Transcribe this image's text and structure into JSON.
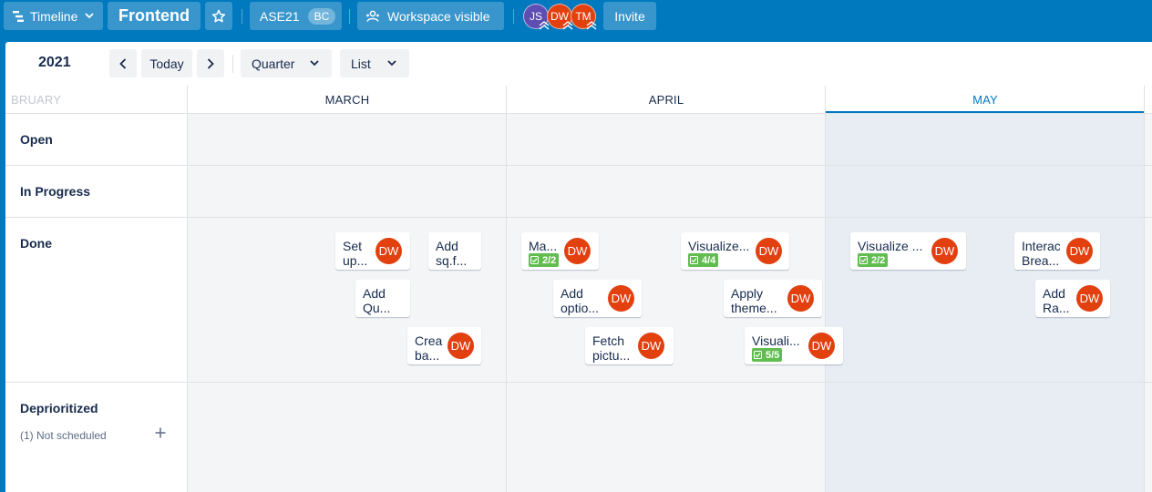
{
  "topbar": {
    "view_switcher": "Timeline",
    "board_name": "Frontend",
    "workspace_name": "ASE21",
    "workspace_badge": "BC",
    "visibility": "Workspace visible",
    "members": [
      "JS",
      "DW",
      "TM"
    ],
    "invite": "Invite"
  },
  "toolbar": {
    "year": "2021",
    "today": "Today",
    "range": "Quarter",
    "group_by": "List"
  },
  "months": {
    "prev": "BRUARY",
    "m1": "MARCH",
    "m2": "APRIL",
    "m3": "MAY"
  },
  "lanes": {
    "open": "Open",
    "in_progress": "In Progress",
    "done": "Done",
    "deprioritized": "Deprioritized",
    "not_scheduled": "(1) Not scheduled"
  },
  "cards": {
    "c1": {
      "line1": "Set",
      "line2": "up...",
      "member": "DW"
    },
    "c2": {
      "line1": "Add",
      "line2": "sq.f..."
    },
    "c3": {
      "line1": "Add",
      "line2": "Qu..."
    },
    "c4": {
      "line1": "Crea",
      "line2": "ba...",
      "member": "DW"
    },
    "c5": {
      "line1": "Ma...",
      "badge": "2/2",
      "member": "DW"
    },
    "c6": {
      "line1": "Add",
      "line2": "optio...",
      "member": "DW"
    },
    "c7": {
      "line1": "Fetch",
      "line2": "pictu...",
      "member": "DW"
    },
    "c8": {
      "line1": "Visualize...",
      "badge": "4/4",
      "member": "DW"
    },
    "c9": {
      "line1": "Apply",
      "line2": "theme...",
      "member": "DW"
    },
    "c10": {
      "line1": "Visuali...",
      "badge": "5/5",
      "member": "DW"
    },
    "c11": {
      "line1": "Visualize ...",
      "badge": "2/2",
      "member": "DW"
    },
    "c12": {
      "line1": "Interac",
      "line2": "Brea...",
      "member": "DW"
    },
    "c13": {
      "line1": "Add",
      "line2": "Ra...",
      "member": "DW"
    }
  },
  "colors": {
    "header_bg": "#0079bf",
    "member_avatar": "#e2400f",
    "avatar_js": "#5e4db2",
    "checklist_badge": "#61bd4f",
    "current_month_bg": "#e8edf3",
    "current_month_accent": "#0079bf"
  },
  "icons": [
    "timeline-icon",
    "chevron-down-icon",
    "star-icon",
    "workspace-icon",
    "chevron-left-icon",
    "chevron-right-icon",
    "checklist-icon",
    "plus-icon"
  ]
}
